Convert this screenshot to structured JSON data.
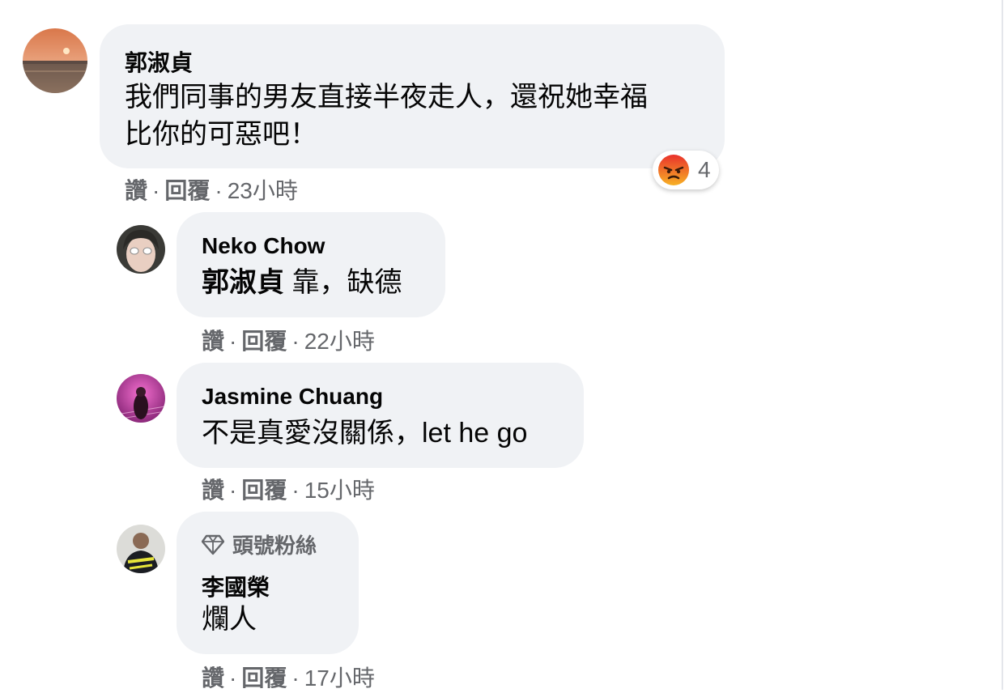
{
  "comments": [
    {
      "author": "郭淑貞",
      "text_line1": "我們同事的男友直接半夜走人，還祝她幸福",
      "text_line2": "比你的可惡吧！",
      "reaction_icon": "angry-emoji-icon",
      "reaction_count": "4",
      "like": "讚",
      "reply": "回覆",
      "time": "23小時"
    },
    {
      "author": "Neko Chow",
      "mention": "郭淑貞",
      "text": " 靠，缺德",
      "like": "讚",
      "reply": "回覆",
      "time": "22小時"
    },
    {
      "author": "Jasmine Chuang",
      "text": "不是真愛沒關係，let he go",
      "like": "讚",
      "reply": "回覆",
      "time": "15小時"
    },
    {
      "badge_icon": "diamond-icon",
      "badge": "頭號粉絲",
      "author": "李國榮",
      "text": "爛人",
      "like": "讚",
      "reply": "回覆",
      "time": "17小時"
    }
  ],
  "separator": "·",
  "colors": {
    "bubble": "#f0f2f5",
    "meta": "#65676b",
    "text": "#050505",
    "angry": "#f0572b"
  }
}
